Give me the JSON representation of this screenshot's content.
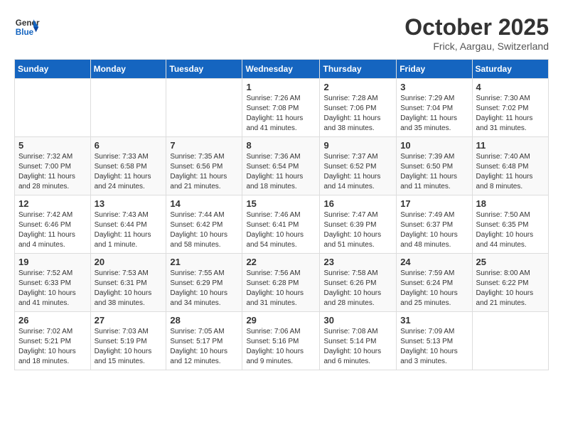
{
  "header": {
    "logo_line1": "General",
    "logo_line2": "Blue",
    "month": "October 2025",
    "location": "Frick, Aargau, Switzerland"
  },
  "weekdays": [
    "Sunday",
    "Monday",
    "Tuesday",
    "Wednesday",
    "Thursday",
    "Friday",
    "Saturday"
  ],
  "weeks": [
    [
      {
        "day": "",
        "info": ""
      },
      {
        "day": "",
        "info": ""
      },
      {
        "day": "",
        "info": ""
      },
      {
        "day": "1",
        "info": "Sunrise: 7:26 AM\nSunset: 7:08 PM\nDaylight: 11 hours\nand 41 minutes."
      },
      {
        "day": "2",
        "info": "Sunrise: 7:28 AM\nSunset: 7:06 PM\nDaylight: 11 hours\nand 38 minutes."
      },
      {
        "day": "3",
        "info": "Sunrise: 7:29 AM\nSunset: 7:04 PM\nDaylight: 11 hours\nand 35 minutes."
      },
      {
        "day": "4",
        "info": "Sunrise: 7:30 AM\nSunset: 7:02 PM\nDaylight: 11 hours\nand 31 minutes."
      }
    ],
    [
      {
        "day": "5",
        "info": "Sunrise: 7:32 AM\nSunset: 7:00 PM\nDaylight: 11 hours\nand 28 minutes."
      },
      {
        "day": "6",
        "info": "Sunrise: 7:33 AM\nSunset: 6:58 PM\nDaylight: 11 hours\nand 24 minutes."
      },
      {
        "day": "7",
        "info": "Sunrise: 7:35 AM\nSunset: 6:56 PM\nDaylight: 11 hours\nand 21 minutes."
      },
      {
        "day": "8",
        "info": "Sunrise: 7:36 AM\nSunset: 6:54 PM\nDaylight: 11 hours\nand 18 minutes."
      },
      {
        "day": "9",
        "info": "Sunrise: 7:37 AM\nSunset: 6:52 PM\nDaylight: 11 hours\nand 14 minutes."
      },
      {
        "day": "10",
        "info": "Sunrise: 7:39 AM\nSunset: 6:50 PM\nDaylight: 11 hours\nand 11 minutes."
      },
      {
        "day": "11",
        "info": "Sunrise: 7:40 AM\nSunset: 6:48 PM\nDaylight: 11 hours\nand 8 minutes."
      }
    ],
    [
      {
        "day": "12",
        "info": "Sunrise: 7:42 AM\nSunset: 6:46 PM\nDaylight: 11 hours\nand 4 minutes."
      },
      {
        "day": "13",
        "info": "Sunrise: 7:43 AM\nSunset: 6:44 PM\nDaylight: 11 hours\nand 1 minute."
      },
      {
        "day": "14",
        "info": "Sunrise: 7:44 AM\nSunset: 6:42 PM\nDaylight: 10 hours\nand 58 minutes."
      },
      {
        "day": "15",
        "info": "Sunrise: 7:46 AM\nSunset: 6:41 PM\nDaylight: 10 hours\nand 54 minutes."
      },
      {
        "day": "16",
        "info": "Sunrise: 7:47 AM\nSunset: 6:39 PM\nDaylight: 10 hours\nand 51 minutes."
      },
      {
        "day": "17",
        "info": "Sunrise: 7:49 AM\nSunset: 6:37 PM\nDaylight: 10 hours\nand 48 minutes."
      },
      {
        "day": "18",
        "info": "Sunrise: 7:50 AM\nSunset: 6:35 PM\nDaylight: 10 hours\nand 44 minutes."
      }
    ],
    [
      {
        "day": "19",
        "info": "Sunrise: 7:52 AM\nSunset: 6:33 PM\nDaylight: 10 hours\nand 41 minutes."
      },
      {
        "day": "20",
        "info": "Sunrise: 7:53 AM\nSunset: 6:31 PM\nDaylight: 10 hours\nand 38 minutes."
      },
      {
        "day": "21",
        "info": "Sunrise: 7:55 AM\nSunset: 6:29 PM\nDaylight: 10 hours\nand 34 minutes."
      },
      {
        "day": "22",
        "info": "Sunrise: 7:56 AM\nSunset: 6:28 PM\nDaylight: 10 hours\nand 31 minutes."
      },
      {
        "day": "23",
        "info": "Sunrise: 7:58 AM\nSunset: 6:26 PM\nDaylight: 10 hours\nand 28 minutes."
      },
      {
        "day": "24",
        "info": "Sunrise: 7:59 AM\nSunset: 6:24 PM\nDaylight: 10 hours\nand 25 minutes."
      },
      {
        "day": "25",
        "info": "Sunrise: 8:00 AM\nSunset: 6:22 PM\nDaylight: 10 hours\nand 21 minutes."
      }
    ],
    [
      {
        "day": "26",
        "info": "Sunrise: 7:02 AM\nSunset: 5:21 PM\nDaylight: 10 hours\nand 18 minutes."
      },
      {
        "day": "27",
        "info": "Sunrise: 7:03 AM\nSunset: 5:19 PM\nDaylight: 10 hours\nand 15 minutes."
      },
      {
        "day": "28",
        "info": "Sunrise: 7:05 AM\nSunset: 5:17 PM\nDaylight: 10 hours\nand 12 minutes."
      },
      {
        "day": "29",
        "info": "Sunrise: 7:06 AM\nSunset: 5:16 PM\nDaylight: 10 hours\nand 9 minutes."
      },
      {
        "day": "30",
        "info": "Sunrise: 7:08 AM\nSunset: 5:14 PM\nDaylight: 10 hours\nand 6 minutes."
      },
      {
        "day": "31",
        "info": "Sunrise: 7:09 AM\nSunset: 5:13 PM\nDaylight: 10 hours\nand 3 minutes."
      },
      {
        "day": "",
        "info": ""
      }
    ]
  ]
}
